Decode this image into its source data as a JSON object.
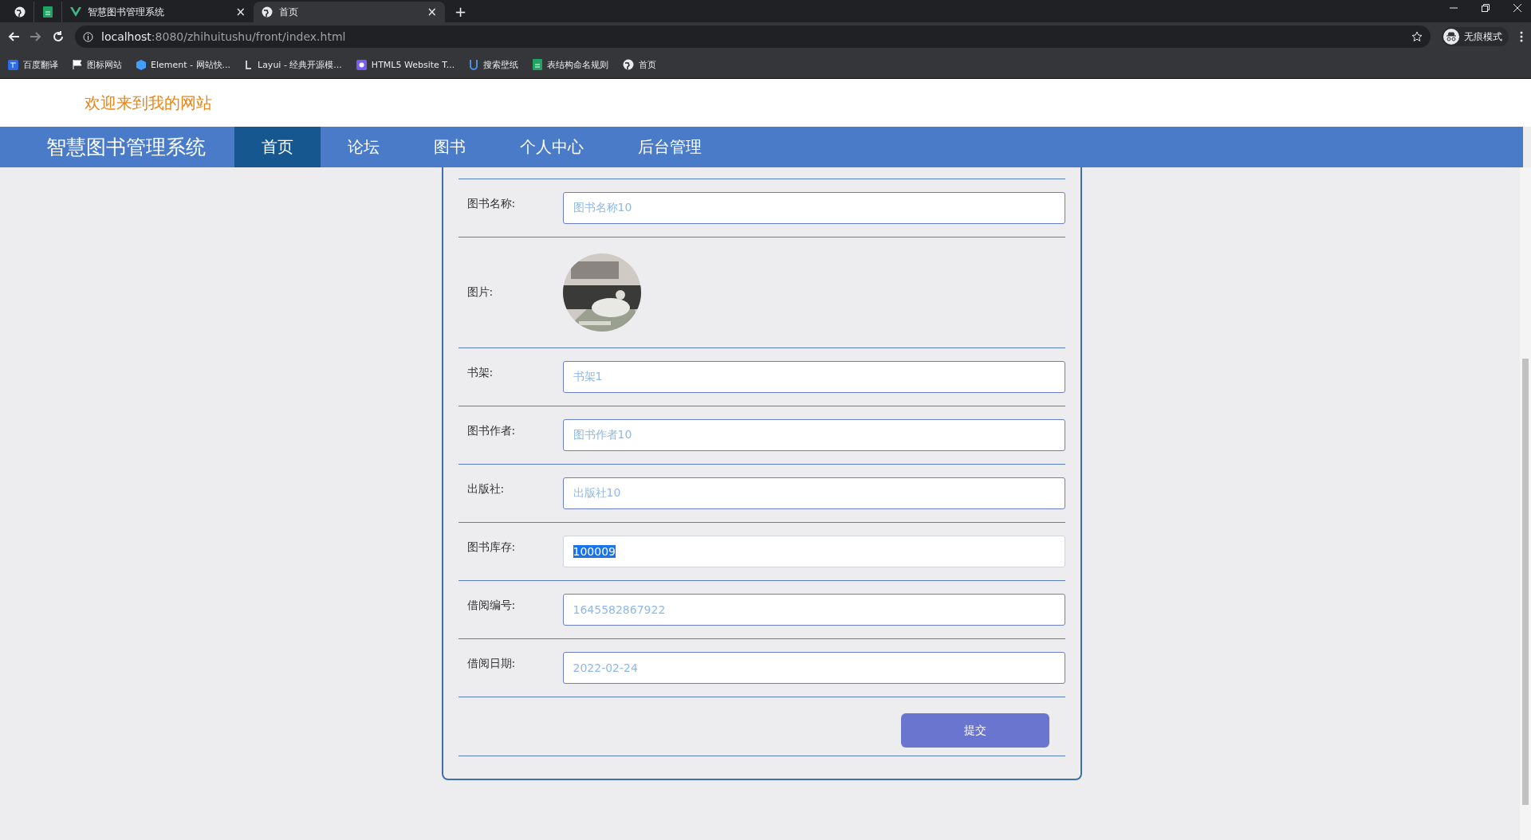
{
  "browser": {
    "tabs": [
      {
        "kind": "pinned",
        "selected": false
      },
      {
        "kind": "pinned",
        "selected": false
      },
      {
        "kind": "tab",
        "title": "智慧图书管理系统",
        "close": "×",
        "selected": false
      },
      {
        "kind": "tab",
        "title": "首页",
        "close": "×",
        "selected": true
      }
    ],
    "new_tab": "+",
    "url": {
      "host": "localhost",
      "rest": ":8080/zhihuitushu/front/index.html"
    },
    "profile": "无痕模式",
    "bookmarks": [
      {
        "label": "百度翻译"
      },
      {
        "label": "图标网站"
      },
      {
        "label": "Element - 网站快..."
      },
      {
        "label": "Layui - 经典开源模..."
      },
      {
        "label": "HTML5 Website T..."
      },
      {
        "label": "搜索壁纸"
      },
      {
        "label": "表结构命名规则"
      },
      {
        "label": "首页"
      }
    ]
  },
  "header": {
    "welcome": "欢迎来到我的网站"
  },
  "nav": {
    "logo": "智慧图书管理系统",
    "items": [
      {
        "label": "首页",
        "selected": true
      },
      {
        "label": "论坛",
        "selected": false
      },
      {
        "label": "图书",
        "selected": false
      },
      {
        "label": "个人中心",
        "selected": false
      },
      {
        "label": "后台管理",
        "selected": false
      }
    ]
  },
  "form": {
    "rows": [
      {
        "kind": "text",
        "label": "图书名称:",
        "value": "图书名称10",
        "editable": false,
        "text_selected": false
      },
      {
        "label": "图片:"
      },
      {
        "kind": "text",
        "label": "书架:",
        "value": "书架1",
        "editable": false,
        "text_selected": false
      },
      {
        "kind": "text",
        "label": "图书作者:",
        "value": "图书作者10",
        "editable": false,
        "text_selected": false
      },
      {
        "kind": "text",
        "label": "出版社:",
        "value": "出版社10",
        "editable": false,
        "text_selected": false
      },
      {
        "kind": "text",
        "label": "图书库存:",
        "value": "100009",
        "editable": true,
        "text_selected": true
      },
      {
        "kind": "text",
        "label": "借阅编号:",
        "value": "1645582867922",
        "editable": false,
        "text_selected": false
      },
      {
        "kind": "text",
        "label": "借阅日期:",
        "value": "2022-02-24",
        "editable": false,
        "text_selected": false
      }
    ],
    "submit": "提交"
  }
}
